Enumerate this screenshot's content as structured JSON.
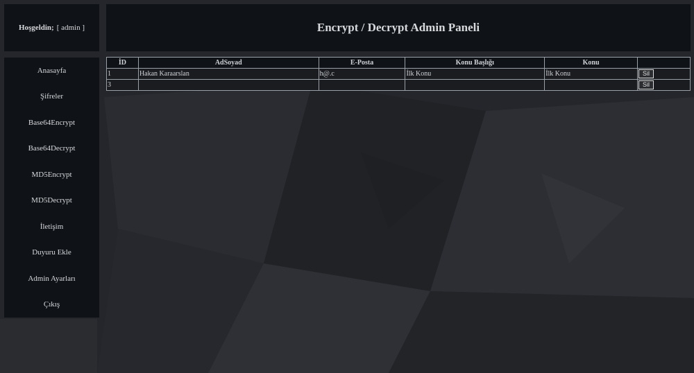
{
  "welcome": {
    "label": "Hoşgeldin;",
    "user": "[ admin ]"
  },
  "header": {
    "title": "Encrypt / Decrypt Admin Paneli"
  },
  "sidebar": {
    "items": [
      {
        "label": "Anasayfa"
      },
      {
        "label": "Şifreler"
      },
      {
        "label": "Base64Encrypt"
      },
      {
        "label": "Base64Decrypt"
      },
      {
        "label": "MD5Encrypt"
      },
      {
        "label": "MD5Decrypt"
      },
      {
        "label": "İletişim"
      },
      {
        "label": "Duyuru Ekle"
      },
      {
        "label": "Admin Ayarları"
      },
      {
        "label": "Çıkış"
      }
    ]
  },
  "table": {
    "headers": [
      "İD",
      "AdSoyad",
      "E-Posta",
      "Konu Başlığı",
      "Konu",
      ""
    ],
    "rows": [
      {
        "id": "1",
        "name": "Hakan Karaarslan",
        "email": "h@.c",
        "subject": "İlk Konu",
        "topic": "İlk Konu",
        "action": "Sil"
      },
      {
        "id": "3",
        "name": "",
        "email": "",
        "subject": "",
        "topic": "",
        "action": "Sil"
      }
    ]
  },
  "colors": {
    "panel": "#0f1217",
    "background": "#24262b",
    "text": "#d7d9dc"
  }
}
